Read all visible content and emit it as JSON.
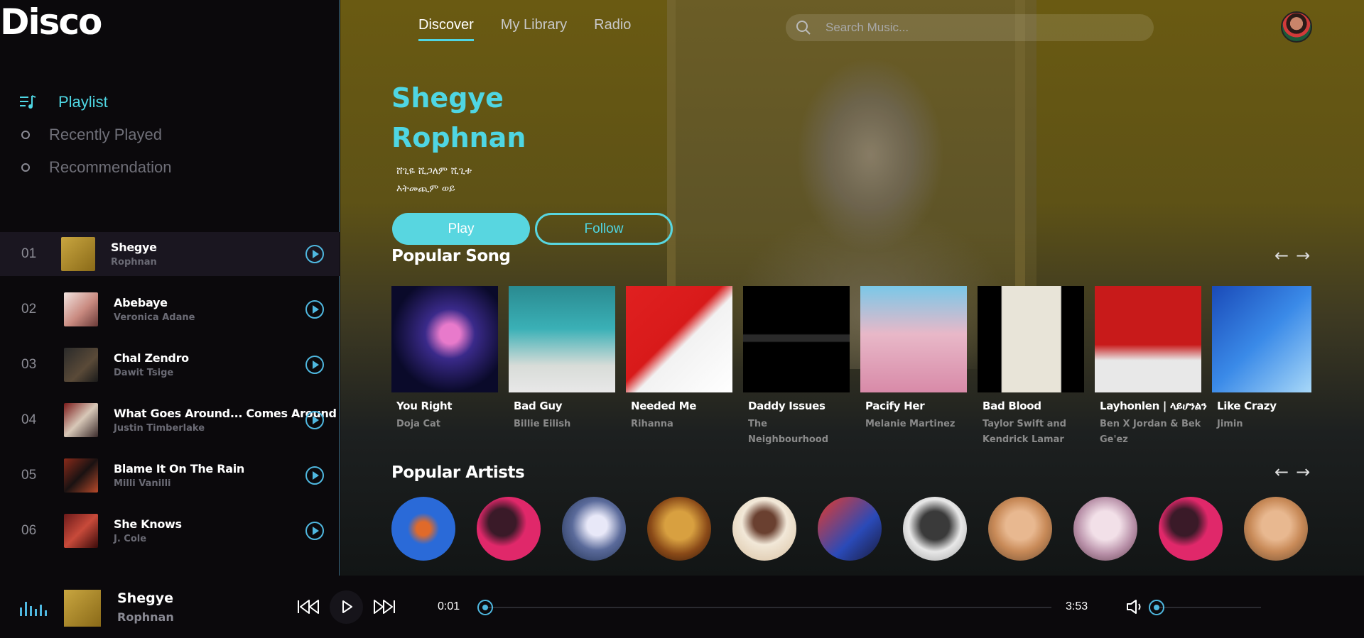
{
  "app": {
    "logo": "Disco"
  },
  "sidebar": {
    "nav": [
      {
        "label": "Playlist",
        "active": true
      },
      {
        "label": "Recently Played",
        "active": false
      },
      {
        "label": "Recommendation",
        "active": false
      }
    ],
    "tracks": [
      {
        "num": "01",
        "title": "Shegye",
        "artist": "Rophnan",
        "active": true
      },
      {
        "num": "02",
        "title": "Abebaye",
        "artist": "Veronica Adane"
      },
      {
        "num": "03",
        "title": "Chal Zendro",
        "artist": "Dawit Tsige"
      },
      {
        "num": "04",
        "title": "What Goes Around... Comes Around",
        "artist": "Justin Timberlake"
      },
      {
        "num": "05",
        "title": "Blame It On The Rain",
        "artist": "Milli Vanilli"
      },
      {
        "num": "06",
        "title": "She Knows",
        "artist": "J. Cole"
      }
    ]
  },
  "header": {
    "tabs": [
      {
        "label": "Discover",
        "active": true
      },
      {
        "label": "My Library"
      },
      {
        "label": "Radio"
      }
    ],
    "search_placeholder": "Search Music..."
  },
  "hero": {
    "title": "Shegye Rophnan",
    "sub_line1": "ሸጊዬ ሺጋለም ሺጊቱ",
    "sub_line2": "እትመጪም ወይ",
    "play_label": "Play",
    "follow_label": "Follow"
  },
  "popular_songs": {
    "title": "Popular Song",
    "prev": "←",
    "next": "→",
    "items": [
      {
        "title": "You Right",
        "artist": "Doja Cat"
      },
      {
        "title": "Bad Guy",
        "artist": "Billie Eilish"
      },
      {
        "title": "Needed Me",
        "artist": "Rihanna"
      },
      {
        "title": "Daddy Issues",
        "artist": "The Neighbourhood"
      },
      {
        "title": "Pacify Her",
        "artist": "Melanie Martinez"
      },
      {
        "title": "Bad Blood",
        "artist": "Taylor Swift and Kendrick Lamar"
      },
      {
        "title": "Layhonlen | ላይሆንልን",
        "artist": "Ben X Jordan & Bek Ge'ez"
      },
      {
        "title": "Like Crazy",
        "artist": "Jimin"
      }
    ]
  },
  "popular_artists": {
    "title": "Popular Artists",
    "prev": "←",
    "next": "→"
  },
  "player": {
    "title": "Shegye",
    "artist": "Rophnan",
    "current_time": "0:01",
    "duration": "3:53",
    "progress": 0.0,
    "volume": 0.0
  },
  "colors": {
    "accent": "#4fd6e3",
    "accent_blue": "#4fb8e0"
  }
}
